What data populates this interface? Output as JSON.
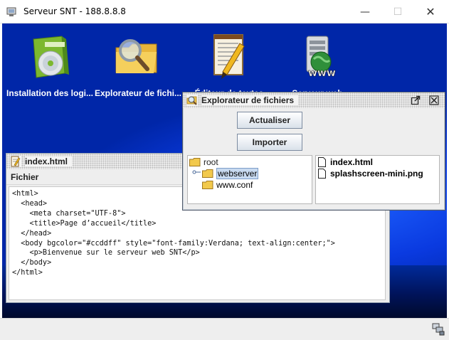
{
  "window": {
    "title": "Serveur SNT - 188.8.8.8",
    "minimize_glyph": "—",
    "maximize_glyph": "☐",
    "close_glyph": "✕"
  },
  "desktop": {
    "icons": [
      {
        "label": "Installation des logi...",
        "icon": "software-cd-icon"
      },
      {
        "label": "Explorateur de fichi...",
        "icon": "folder-magnifier-icon"
      },
      {
        "label": "Éditeur de textes",
        "icon": "notepad-pencil-icon"
      },
      {
        "label": "Serveur web",
        "icon": "web-server-icon"
      }
    ]
  },
  "editor": {
    "title": "index.html",
    "menu": [
      "Fichier"
    ],
    "code_lines": [
      "<html>",
      "  <head>",
      "    <meta charset=\"UTF-8\">",
      "    <title>Page d’accueil</title>",
      "  </head>",
      "  <body bgcolor=\"#ccddff\" style=\"font-family:Verdana; text-align:center;\">",
      "    <p>Bienvenue sur le serveur web SNT</p>",
      "  </body>",
      "</html>"
    ]
  },
  "explorer": {
    "title": "Explorateur de fichiers",
    "buttons": {
      "refresh": "Actualiser",
      "import": "Importer"
    },
    "tree": {
      "root": "root",
      "children": [
        "webserver",
        "www.conf"
      ],
      "selected": "webserver"
    },
    "files": [
      "index.html",
      "splashscreen-mini.png"
    ]
  },
  "colors": {
    "desktop": "#0a3ae0",
    "selection": "#c8daf0"
  }
}
